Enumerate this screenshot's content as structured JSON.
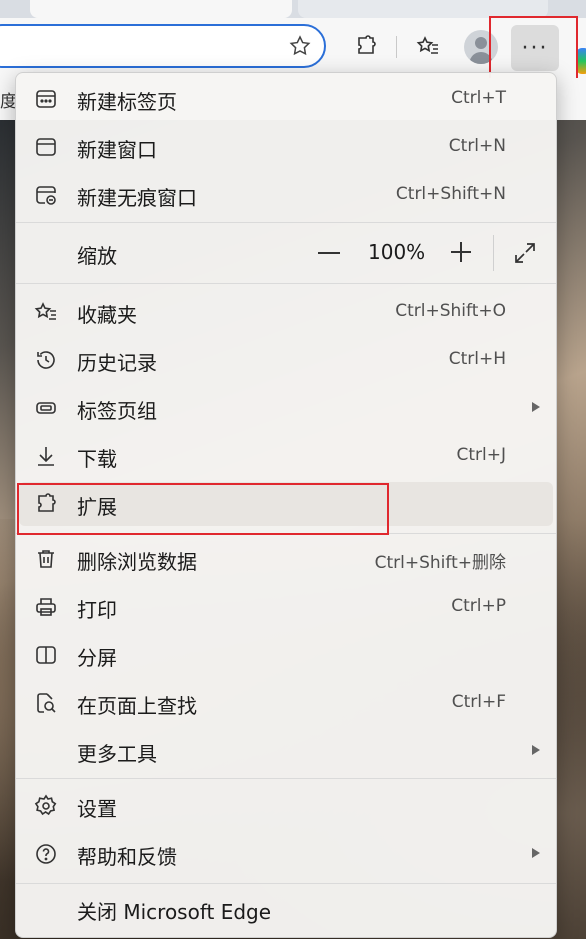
{
  "browser": {
    "bookmark_fragment": "度",
    "more_button_label": "···"
  },
  "menu": {
    "items": [
      {
        "label": "新建标签页",
        "shortcut": "Ctrl+T"
      },
      {
        "label": "新建窗口",
        "shortcut": "Ctrl+N"
      },
      {
        "label": "新建无痕窗口",
        "shortcut": "Ctrl+Shift+N"
      },
      {
        "label": "缩放",
        "shortcut": ""
      },
      {
        "label": "收藏夹",
        "shortcut": "Ctrl+Shift+O"
      },
      {
        "label": "历史记录",
        "shortcut": "Ctrl+H"
      },
      {
        "label": "标签页组",
        "shortcut": ""
      },
      {
        "label": "下载",
        "shortcut": "Ctrl+J"
      },
      {
        "label": "扩展",
        "shortcut": ""
      },
      {
        "label": "删除浏览数据",
        "shortcut": "Ctrl+Shift+删除"
      },
      {
        "label": "打印",
        "shortcut": "Ctrl+P"
      },
      {
        "label": "分屏",
        "shortcut": ""
      },
      {
        "label": "在页面上查找",
        "shortcut": "Ctrl+F"
      },
      {
        "label": "更多工具",
        "shortcut": ""
      },
      {
        "label": "设置",
        "shortcut": ""
      },
      {
        "label": "帮助和反馈",
        "shortcut": ""
      },
      {
        "label": "关闭 Microsoft Edge",
        "shortcut": ""
      }
    ],
    "zoom": {
      "value": "100%"
    }
  },
  "colors": {
    "highlight_border": "#e0282e",
    "address_border": "#2b6fd8"
  }
}
